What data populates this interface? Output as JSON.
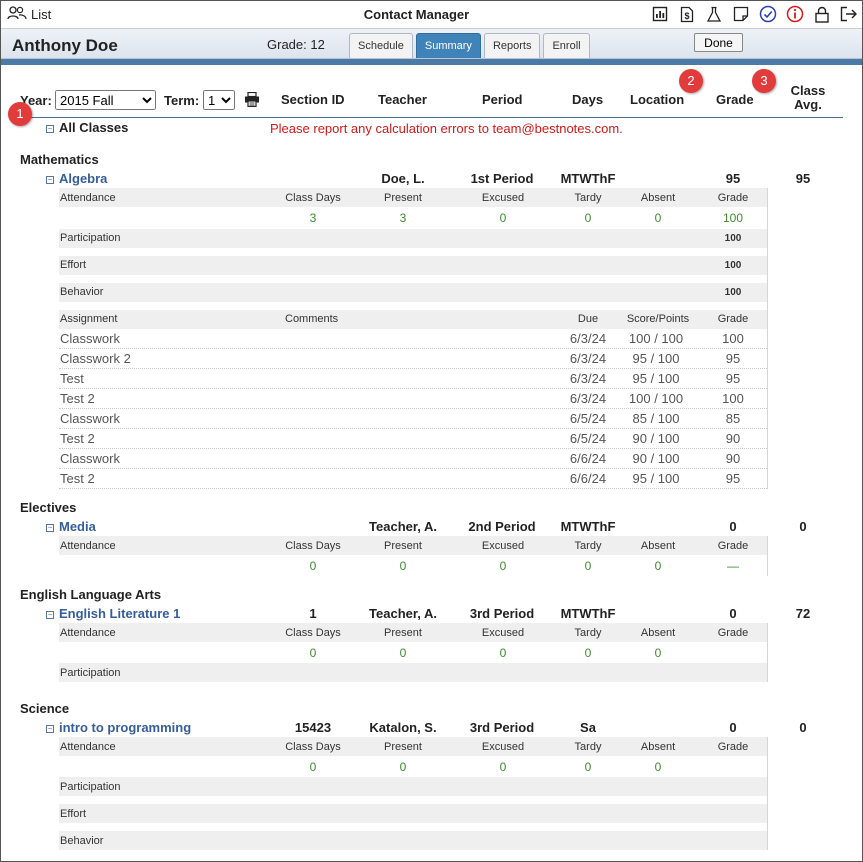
{
  "app": {
    "list_label": "List",
    "title": "Contact Manager"
  },
  "header": {
    "student_name": "Anthony Doe",
    "grade_label": "Grade: 12",
    "tabs": [
      "Schedule",
      "Summary",
      "Reports",
      "Enroll"
    ],
    "active_tab": "Summary",
    "done_label": "Done"
  },
  "toolbar_icons": [
    "chart-icon",
    "dollar-doc-icon",
    "flask-icon",
    "note-icon",
    "check-circle-icon",
    "info-icon",
    "lock-icon",
    "logout-icon"
  ],
  "filters": {
    "year_label": "Year:",
    "year_value": "2015 Fall",
    "term_label": "Term:",
    "term_value": "1"
  },
  "columns": {
    "section_id": "Section ID",
    "teacher": "Teacher",
    "period": "Period",
    "days": "Days",
    "location": "Location",
    "grade": "Grade",
    "class_avg": "Class Avg."
  },
  "badges": [
    "1",
    "2",
    "3"
  ],
  "all_classes_label": "All Classes",
  "error_message": "Please report any calculation errors to team@bestnotes.com.",
  "attendance_headers": {
    "attendance": "Attendance",
    "class_days": "Class Days",
    "present": "Present",
    "excused": "Excused",
    "tardy": "Tardy",
    "absent": "Absent",
    "grade": "Grade"
  },
  "assignment_headers": {
    "assignment": "Assignment",
    "comments": "Comments",
    "due": "Due",
    "score_points": "Score/Points",
    "grade": "Grade"
  },
  "row_labels": {
    "participation": "Participation",
    "effort": "Effort",
    "behavior": "Behavior"
  },
  "subjects": [
    {
      "name": "Mathematics",
      "class": {
        "name": "Algebra",
        "section_id": "",
        "teacher": "Doe, L.",
        "period": "1st Period",
        "days": "MTWThF",
        "grade": "95",
        "class_avg": "95",
        "attendance": {
          "class_days": "3",
          "present": "3",
          "excused": "0",
          "tardy": "0",
          "absent": "0",
          "grade": "100"
        },
        "participation": "100",
        "effort": "100",
        "behavior": "100",
        "assignments": [
          {
            "name": "Classwork",
            "due": "6/3/24",
            "score": "100 / 100",
            "grade": "100"
          },
          {
            "name": "Classwork 2",
            "due": "6/3/24",
            "score": "95 / 100",
            "grade": "95"
          },
          {
            "name": "Test",
            "due": "6/3/24",
            "score": "95 / 100",
            "grade": "95"
          },
          {
            "name": "Test 2",
            "due": "6/3/24",
            "score": "100 / 100",
            "grade": "100"
          },
          {
            "name": "Classwork",
            "due": "6/5/24",
            "score": "85 / 100",
            "grade": "85"
          },
          {
            "name": "Test 2",
            "due": "6/5/24",
            "score": "90 / 100",
            "grade": "90"
          },
          {
            "name": "Classwork",
            "due": "6/6/24",
            "score": "90 / 100",
            "grade": "90"
          },
          {
            "name": "Test 2",
            "due": "6/6/24",
            "score": "95 / 100",
            "grade": "95"
          }
        ]
      }
    },
    {
      "name": "Electives",
      "class": {
        "name": "Media",
        "section_id": "",
        "teacher": "Teacher, A.",
        "period": "2nd Period",
        "days": "MTWThF",
        "grade": "0",
        "class_avg": "0",
        "attendance": {
          "class_days": "0",
          "present": "0",
          "excused": "0",
          "tardy": "0",
          "absent": "0",
          "grade": "—"
        }
      }
    },
    {
      "name": "English Language Arts",
      "class": {
        "name": "English Literature 1",
        "section_id": "1",
        "teacher": "Teacher, A.",
        "period": "3rd Period",
        "days": "MTWThF",
        "grade": "0",
        "class_avg": "72",
        "attendance": {
          "class_days": "0",
          "present": "0",
          "excused": "0",
          "tardy": "0",
          "absent": "0"
        }
      }
    },
    {
      "name": "Science",
      "class": {
        "name": "intro to programming",
        "section_id": "15423",
        "teacher": "Katalon, S.",
        "period": "3rd Period",
        "days": "Sa",
        "grade": "0",
        "class_avg": "0",
        "attendance": {
          "class_days": "0",
          "present": "0",
          "excused": "0",
          "tardy": "0",
          "absent": "0"
        }
      }
    }
  ]
}
